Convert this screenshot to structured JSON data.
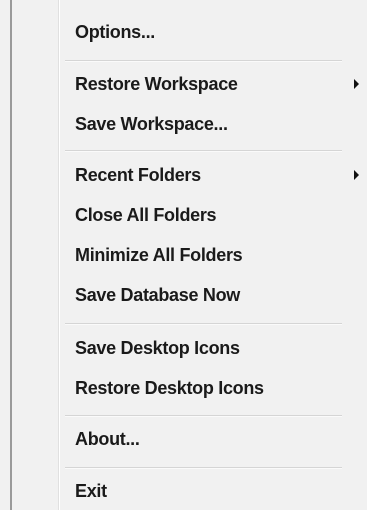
{
  "menu": {
    "items": {
      "options": "Options...",
      "restore_workspace": "Restore Workspace",
      "save_workspace": "Save Workspace...",
      "recent_folders": "Recent Folders",
      "close_all_folders": "Close All Folders",
      "minimize_all_folders": "Minimize All Folders",
      "save_database_now": "Save Database Now",
      "save_desktop_icons": "Save Desktop Icons",
      "restore_desktop_icons": "Restore Desktop Icons",
      "about": "About...",
      "exit": "Exit"
    },
    "submenu_icon": "submenu-arrow-icon",
    "colors": {
      "background": "#f1f1f1",
      "text": "#1a1a1a",
      "separator": "#d5d5d5"
    }
  }
}
